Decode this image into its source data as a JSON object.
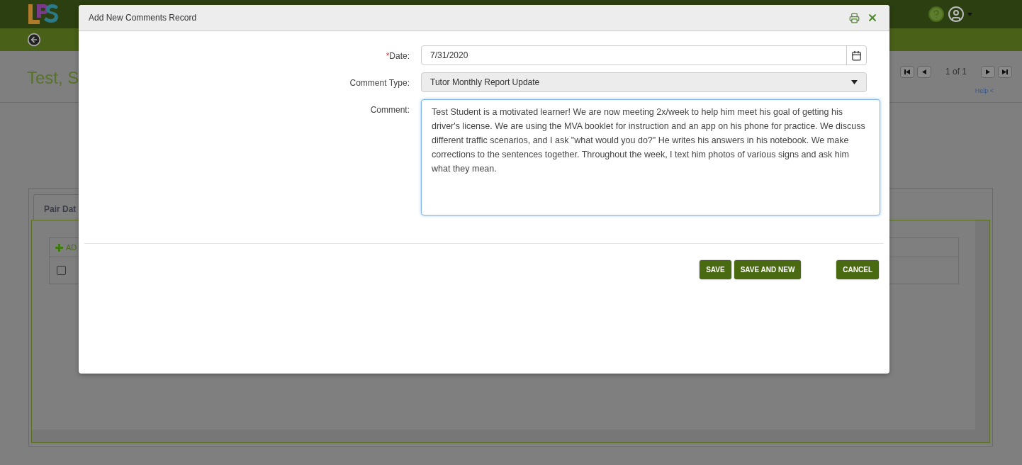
{
  "app_header": {
    "page_title": "Test, S",
    "pager": {
      "text": "1 of 1"
    },
    "help_link": "Help <"
  },
  "panel": {
    "tab": {
      "label": "Pair Dat",
      "selected": true
    },
    "add_button": "AD",
    "row_checkbox": {
      "checked": false
    }
  },
  "dialog": {
    "title": "Add New Comments Record",
    "fields": [
      {
        "kind": "date",
        "required_mark": "*",
        "label": "Date:",
        "value": "7/31/2020"
      },
      {
        "kind": "select",
        "label": "Comment Type:",
        "value": "Tutor Monthly Report Update"
      },
      {
        "kind": "textarea",
        "label": "Comment:",
        "value": "Test Student is a motivated learner! We are now meeting 2x/week to help him meet his goal of getting his driver's license. We are using the MVA booklet for instruction and an app on his phone for practice. We discuss different traffic scenarios, and I ask \"what would you do?\" He writes his answers in his notebook. We make corrections to the sentences together. Throughout the week, I text him photos of various signs and ask him what they mean."
      }
    ],
    "buttons": [
      {
        "label": "SAVE",
        "kind": "save"
      },
      {
        "label": "SAVE AND NEW",
        "kind": "save"
      },
      {
        "label": "CANCEL",
        "kind": "cancel"
      }
    ]
  }
}
